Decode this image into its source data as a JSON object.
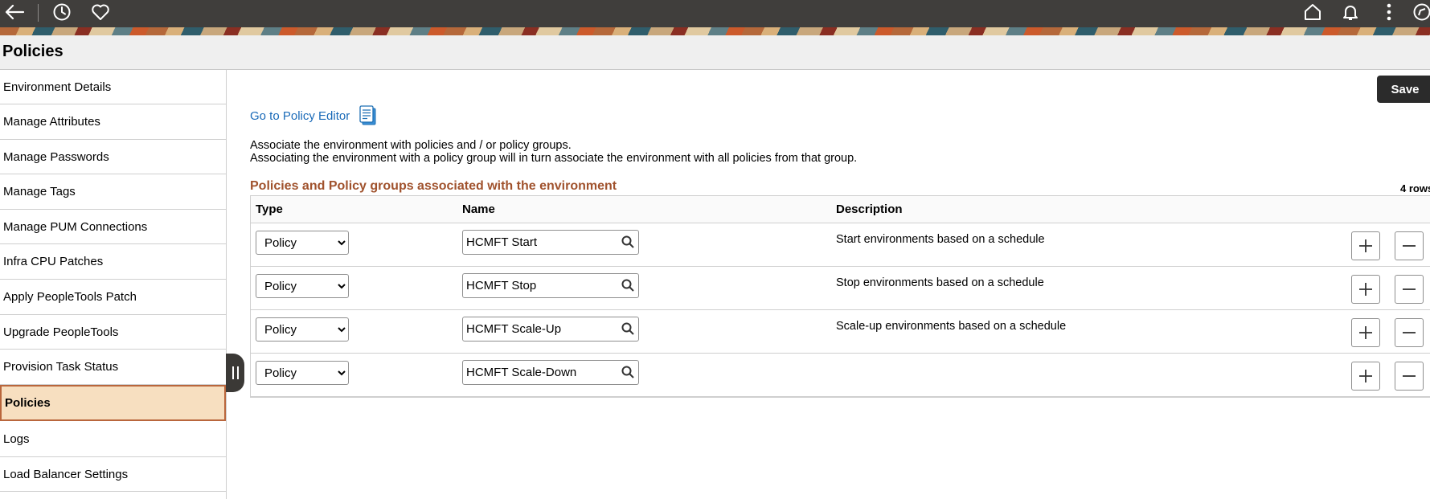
{
  "topbar": {
    "icons": [
      "back-arrow-icon",
      "history-icon",
      "favorites-heart-icon",
      "home-icon",
      "notifications-bell-icon",
      "actions-menu-icon",
      "navbar-compass-icon"
    ]
  },
  "page": {
    "title": "Policies"
  },
  "sidebar": {
    "items": [
      {
        "label": "Environment Details"
      },
      {
        "label": "Manage Attributes"
      },
      {
        "label": "Manage Passwords"
      },
      {
        "label": "Manage Tags"
      },
      {
        "label": "Manage PUM Connections"
      },
      {
        "label": "Infra CPU Patches"
      },
      {
        "label": "Apply PeopleTools Patch"
      },
      {
        "label": "Upgrade PeopleTools"
      },
      {
        "label": "Provision Task Status"
      },
      {
        "label": "Policies",
        "active": true
      },
      {
        "label": "Logs"
      },
      {
        "label": "Load Balancer Settings"
      }
    ]
  },
  "toolbar": {
    "save_label": "Save"
  },
  "main": {
    "policy_editor_link": "Go to Policy Editor",
    "description_line1": "Associate the environment with policies and / or policy groups.",
    "description_line2": "Associating the environment with a policy group will in turn associate the environment with all policies from that group.",
    "section_title": "Policies and Policy groups associated with the environment",
    "row_count": "4 rows"
  },
  "grid": {
    "columns": {
      "type": "Type",
      "name": "Name",
      "description": "Description"
    },
    "rows": [
      {
        "type": "Policy",
        "name": "HCMFT Start",
        "description": "Start environments based on a schedule"
      },
      {
        "type": "Policy",
        "name": "HCMFT Stop",
        "description": "Stop environments based on a schedule"
      },
      {
        "type": "Policy",
        "name": "HCMFT Scale-Up",
        "description": "Scale-up environments based on a schedule"
      },
      {
        "type": "Policy",
        "name": "HCMFT Scale-Down",
        "description": ""
      }
    ]
  },
  "colors": {
    "topbar": "#403e3c",
    "active_item_bg": "#f7dfc0",
    "active_item_border": "#b9663c",
    "section_title": "#a0522d",
    "link": "#1a6ab8"
  }
}
